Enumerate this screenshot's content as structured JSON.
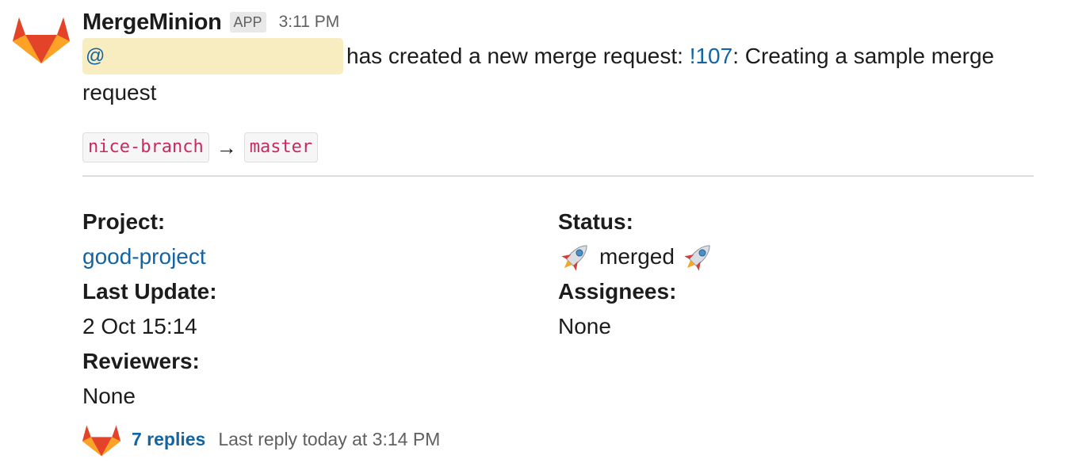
{
  "message": {
    "sender": "MergeMinion",
    "badge": "APP",
    "timestamp": "3:11 PM",
    "mention": "@",
    "text_before_link": "has created a new merge request: ",
    "mr_link": "!107",
    "text_after_link": ": Creating a sample merge request",
    "source_branch": "nice-branch",
    "arrow": "→",
    "target_branch": "master"
  },
  "fields": {
    "project_label": "Project:",
    "project_value": "good-project",
    "last_update_label": "Last Update:",
    "last_update_value": "2 Oct 15:14",
    "reviewers_label": "Reviewers:",
    "reviewers_value": "None",
    "status_label": "Status:",
    "status_value": "merged",
    "status_icon": "rocket-icon",
    "assignees_label": "Assignees:",
    "assignees_value": "None"
  },
  "thread": {
    "replies": "7 replies",
    "last_reply": "Last reply today at 3:14 PM"
  },
  "colors": {
    "link": "#1264a3",
    "mention_bg": "#f8ecc1",
    "code_text": "#c92a5f",
    "gitlab_orange": "#e24329",
    "gitlab_light": "#fca326",
    "gitlab_mid": "#fc6d26"
  }
}
